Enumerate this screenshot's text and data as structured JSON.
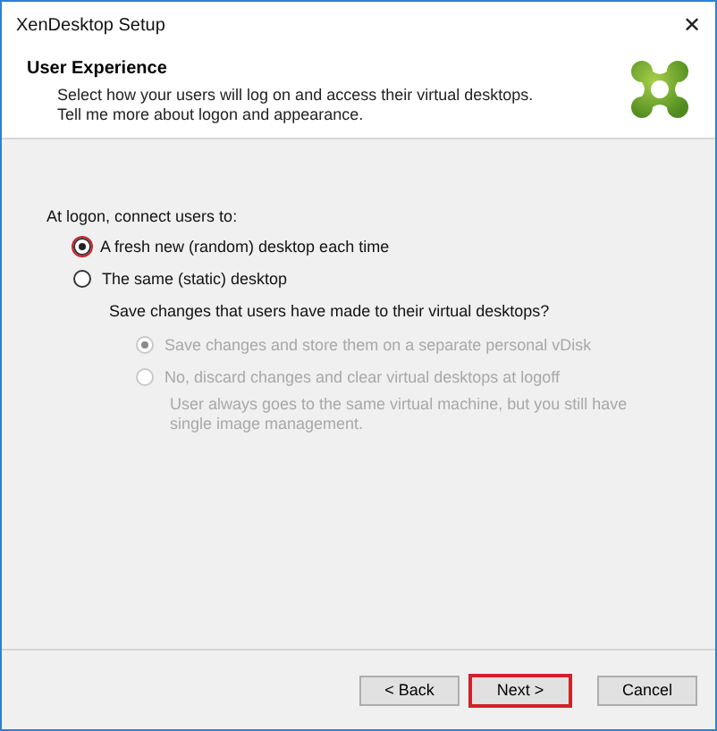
{
  "window": {
    "title": "XenDesktop Setup",
    "close": "✕"
  },
  "header": {
    "title": "User Experience",
    "lines": [
      "Select how your users will log on and access their virtual desktops.",
      "Tell me more about logon and appearance."
    ]
  },
  "prompt": "At logon, connect users to:",
  "options": [
    {
      "label": "A fresh new (random) desktop each time",
      "selected": true,
      "disabled": false,
      "highlighted": true
    },
    {
      "label": "The same (static) desktop",
      "selected": false,
      "disabled": false,
      "highlighted": false,
      "question": "Save changes that users have made to their virtual desktops?",
      "children": [
        {
          "label": "Save changes and store them on a separate personal vDisk",
          "selected": true,
          "disabled": true,
          "highlighted": false
        },
        {
          "label": "No, discard changes and clear virtual desktops at logoff",
          "selected": false,
          "disabled": true,
          "highlighted": false,
          "note": "User always goes to the same virtual machine, but you still have single image management."
        }
      ]
    }
  ],
  "buttons": [
    {
      "label": "< Back",
      "highlighted": false
    },
    {
      "label": "Next >",
      "highlighted": true
    },
    {
      "label": "Cancel",
      "highlighted": false
    }
  ]
}
